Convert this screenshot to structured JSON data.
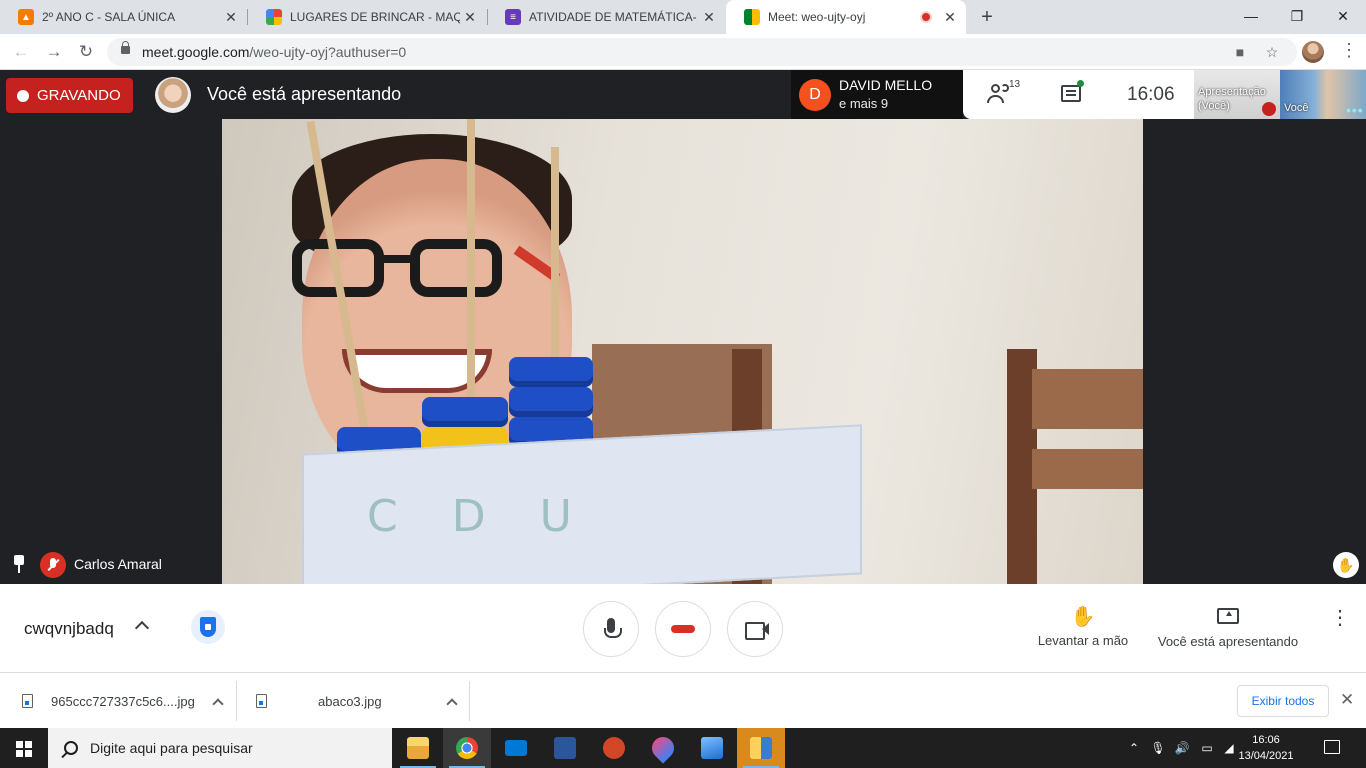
{
  "browser": {
    "tabs": [
      {
        "label": "2º ANO C - SALA ÚNICA",
        "color": "#f57c00"
      },
      {
        "label": "LUGARES DE BRINCAR - MAQUETE",
        "color": "#4285f4"
      },
      {
        "label": "ATIVIDADE DE MATEMÁTICA- SISTEMA",
        "color": "#673ab7"
      },
      {
        "label": "Meet: weo-ujty-oyj",
        "color": "#00897b"
      }
    ],
    "url_host": "meet.google.com",
    "url_path": "/weo-ujty-oyj?authuser=0"
  },
  "meet": {
    "recording_label": "GRAVANDO",
    "presenting_banner": "Você está apresentando",
    "speaker_initial": "D",
    "speaker_name": "DAVID MELLO",
    "speaker_more": "e mais 9",
    "participant_count": "13",
    "time": "16:06",
    "thumb_presentation": "Apresentação",
    "thumb_presentation_sub": "(Você)",
    "thumb_self": "Você",
    "participant_name": "Carlos Amaral",
    "video_letters": "CDU",
    "meeting_code": "cwqvnjbadq",
    "raise_hand_label": "Levantar a mão",
    "present_label": "Você está apresentando"
  },
  "downloads": {
    "items": [
      "965ccc727337c5c6....jpg",
      "abaco3.jpg"
    ],
    "show_all": "Exibir todos"
  },
  "taskbar": {
    "search_placeholder": "Digite aqui para pesquisar",
    "time": "16:06",
    "date": "13/04/2021"
  },
  "colors": {
    "recording": "#c5221f",
    "accent": "#1a73e8",
    "hangup": "#d93025",
    "speaker_avatar": "#f4511e"
  }
}
